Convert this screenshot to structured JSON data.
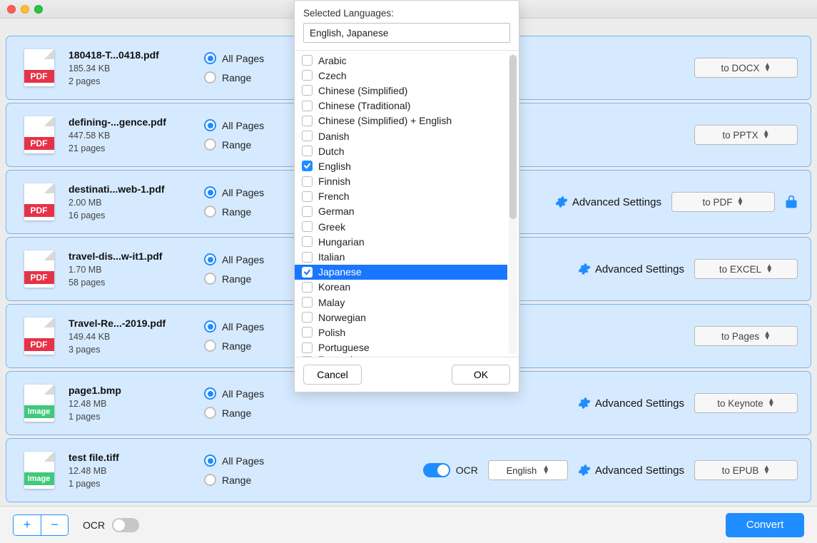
{
  "popover": {
    "title": "Selected Languages:",
    "input_value": "English, Japanese",
    "cancel": "Cancel",
    "ok": "OK",
    "languages": [
      {
        "name": "Arabic",
        "checked": false,
        "highlight": false
      },
      {
        "name": "Czech",
        "checked": false,
        "highlight": false
      },
      {
        "name": "Chinese (Simplified)",
        "checked": false,
        "highlight": false
      },
      {
        "name": "Chinese (Traditional)",
        "checked": false,
        "highlight": false
      },
      {
        "name": "Chinese (Simplified) + English",
        "checked": false,
        "highlight": false
      },
      {
        "name": "Danish",
        "checked": false,
        "highlight": false
      },
      {
        "name": "Dutch",
        "checked": false,
        "highlight": false
      },
      {
        "name": "English",
        "checked": true,
        "highlight": false
      },
      {
        "name": "Finnish",
        "checked": false,
        "highlight": false
      },
      {
        "name": "French",
        "checked": false,
        "highlight": false
      },
      {
        "name": "German",
        "checked": false,
        "highlight": false
      },
      {
        "name": "Greek",
        "checked": false,
        "highlight": false
      },
      {
        "name": "Hungarian",
        "checked": false,
        "highlight": false
      },
      {
        "name": "Italian",
        "checked": false,
        "highlight": false
      },
      {
        "name": "Japanese",
        "checked": true,
        "highlight": true
      },
      {
        "name": "Korean",
        "checked": false,
        "highlight": false
      },
      {
        "name": "Malay",
        "checked": false,
        "highlight": false
      },
      {
        "name": "Norwegian",
        "checked": false,
        "highlight": false
      },
      {
        "name": "Polish",
        "checked": false,
        "highlight": false
      },
      {
        "name": "Portuguese",
        "checked": false,
        "highlight": false
      },
      {
        "name": "Romanian",
        "checked": false,
        "highlight": false,
        "cutoff": true
      }
    ]
  },
  "labels": {
    "all_pages": "All Pages",
    "range": "Range",
    "ocr": "OCR",
    "advanced": "Advanced Settings"
  },
  "lang_dropdown_value": "English",
  "files": [
    {
      "name": "180418-T...0418.pdf",
      "size": "185.34 KB",
      "pages": "2 pages",
      "type": "PDF",
      "ocr_on": false,
      "show_ocr": false,
      "show_adv": false,
      "show_lock": false,
      "output": "to DOCX"
    },
    {
      "name": "defining-...gence.pdf",
      "size": "447.58 KB",
      "pages": "21 pages",
      "type": "PDF",
      "ocr_on": false,
      "show_ocr": false,
      "show_adv": false,
      "show_lock": false,
      "output": "to PPTX"
    },
    {
      "name": "destinati...web-1.pdf",
      "size": "2.00 MB",
      "pages": "16 pages",
      "type": "PDF",
      "ocr_on": false,
      "show_ocr": false,
      "show_adv": true,
      "show_lock": true,
      "output": "to PDF"
    },
    {
      "name": "travel-dis...w-it1.pdf",
      "size": "1.70 MB",
      "pages": "58 pages",
      "type": "PDF",
      "ocr_on": false,
      "show_ocr": false,
      "show_adv": true,
      "show_lock": false,
      "output": "to EXCEL"
    },
    {
      "name": "Travel-Re...-2019.pdf",
      "size": "149.44 KB",
      "pages": "3 pages",
      "type": "PDF",
      "ocr_on": false,
      "show_ocr": false,
      "show_adv": false,
      "show_lock": false,
      "output": "to Pages"
    },
    {
      "name": "page1.bmp",
      "size": "12.48 MB",
      "pages": "1 pages",
      "type": "Image",
      "ocr_on": false,
      "show_ocr": false,
      "show_adv": true,
      "show_lock": false,
      "output": "to Keynote"
    },
    {
      "name": "test file.tiff",
      "size": "12.48 MB",
      "pages": "1 pages",
      "type": "Image",
      "ocr_on": true,
      "show_ocr": true,
      "show_adv": true,
      "show_lock": false,
      "output": "to EPUB"
    }
  ],
  "footer": {
    "ocr": "OCR",
    "convert": "Convert"
  }
}
